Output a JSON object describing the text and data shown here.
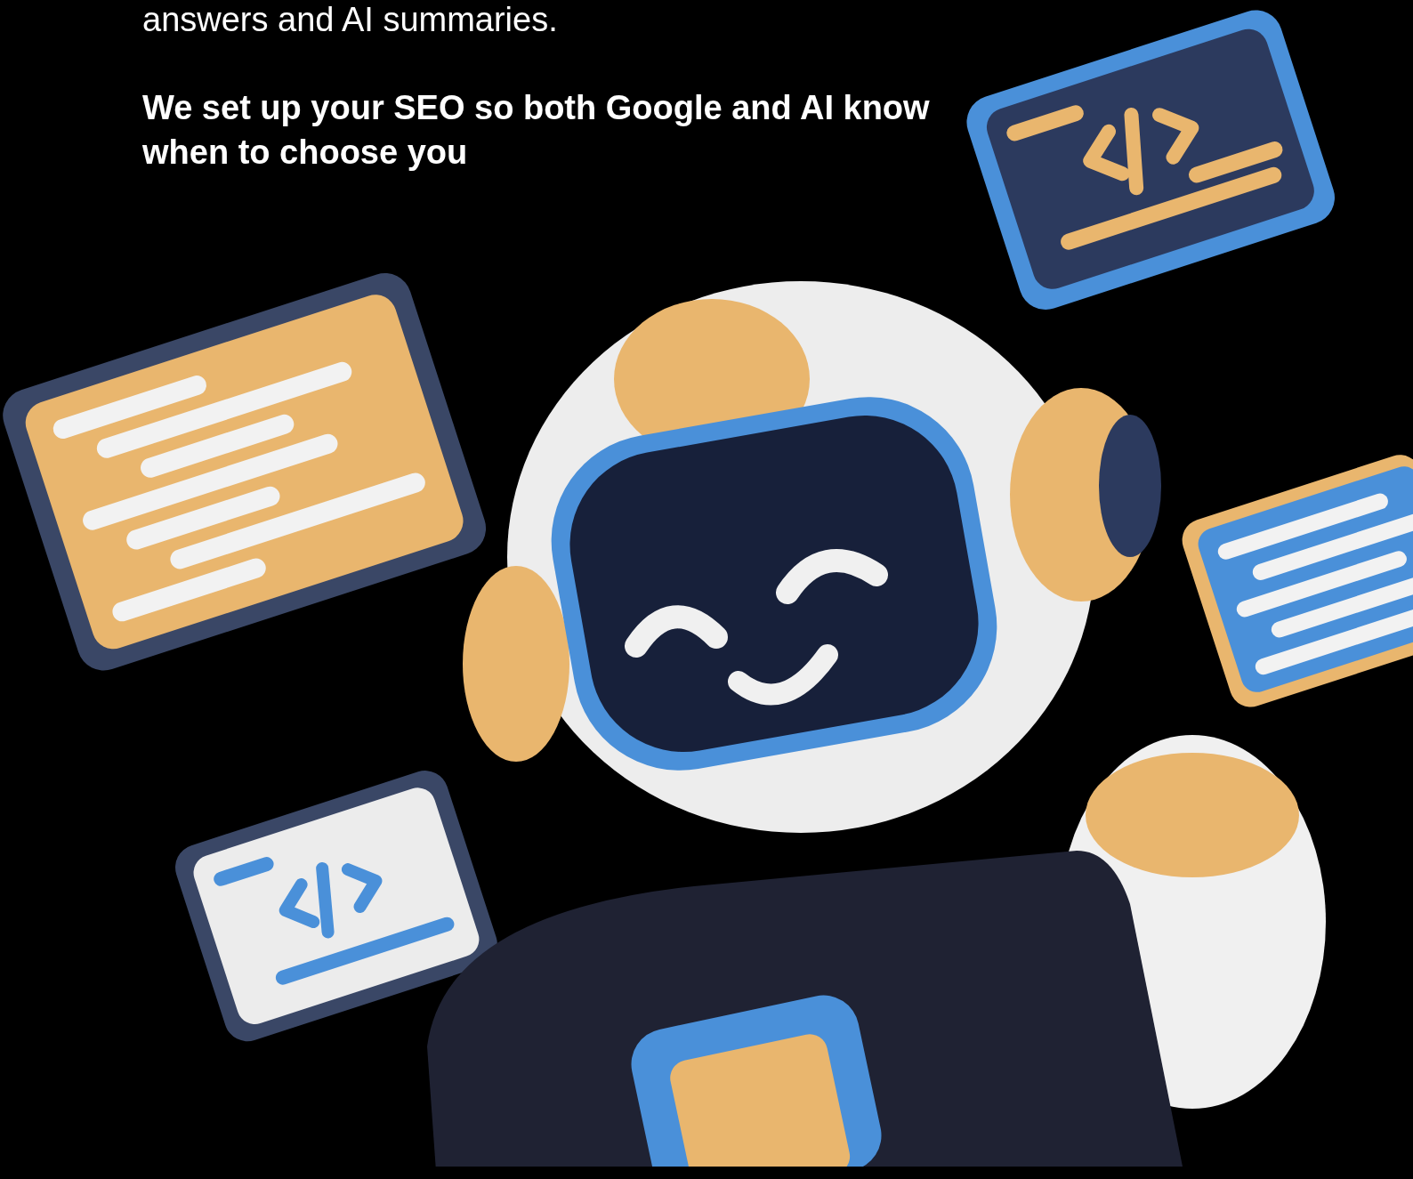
{
  "intro": {
    "text_end": "answers and AI summaries.",
    "headline": "We set up your SEO so both Google and AI know when to choose you"
  }
}
